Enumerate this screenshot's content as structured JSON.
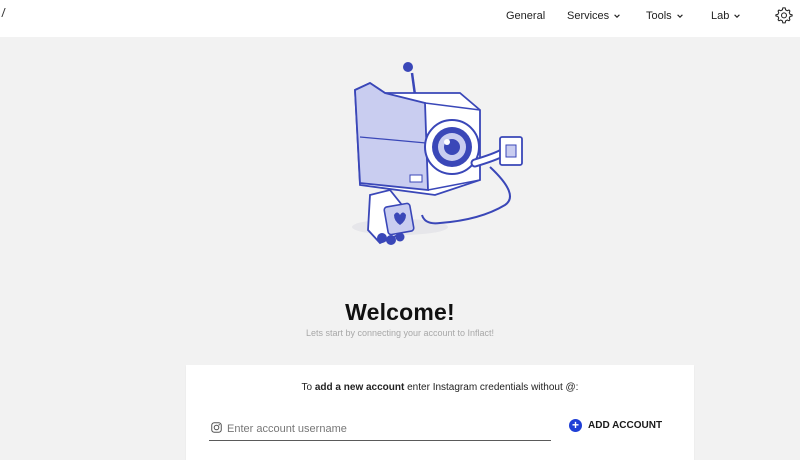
{
  "nav": {
    "general": "General",
    "services": "Services",
    "tools": "Tools",
    "lab": "Lab"
  },
  "icons": {
    "settings": "gear-icon",
    "dropdown": "chevron-down-icon",
    "instagram": "instagram-icon",
    "add": "plus-circle-icon"
  },
  "main": {
    "title": "Welcome!",
    "subtitle": "Lets start by connecting your account to Inflact!"
  },
  "card": {
    "instr_prefix": "To ",
    "instr_bold": "add a new account",
    "instr_suffix": " enter Instagram credentials without @:",
    "username_placeholder": "Enter account username",
    "username_value": "",
    "add_button": "ADD ACCOUNT"
  },
  "colors": {
    "accent": "#1f3fd6",
    "illustration": "#3a47b8",
    "illustration_light": "#c9cdf0",
    "background": "#f2f2f2"
  }
}
